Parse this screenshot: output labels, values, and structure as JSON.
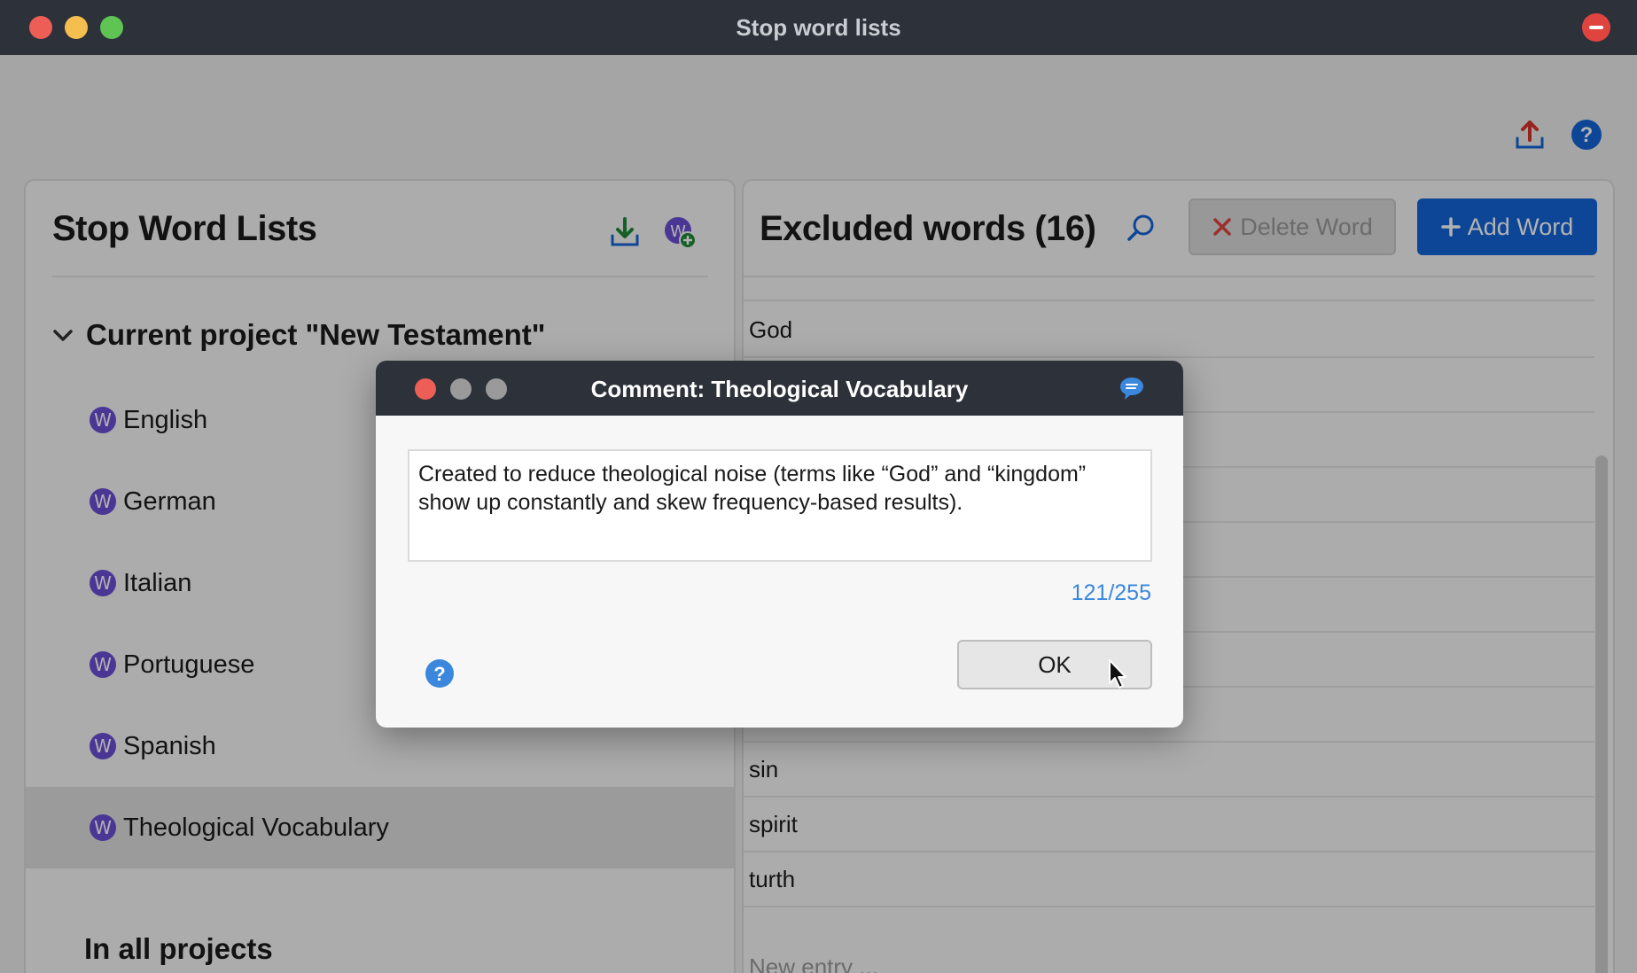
{
  "window": {
    "title": "Stop word lists"
  },
  "left_panel": {
    "title": "Stop Word Lists",
    "group_current": "Current project \"New Testament\"",
    "badge_letter": "W",
    "items": [
      {
        "label": "English"
      },
      {
        "label": "German"
      },
      {
        "label": "Italian"
      },
      {
        "label": "Portuguese"
      },
      {
        "label": "Spanish"
      },
      {
        "label": "Theological Vocabulary"
      }
    ],
    "group_all": "In all projects"
  },
  "right_panel": {
    "title": "Excluded words (16)",
    "delete_label": "Delete Word",
    "add_label": "Add Word",
    "words_visible": [
      "God",
      "sin",
      "spirit",
      "turth"
    ],
    "new_entry_placeholder": "New entry ..."
  },
  "dialog": {
    "title": "Comment: Theological Vocabulary",
    "comment": "Created to reduce theological noise (terms like “God” and “kingdom” show up constantly and skew frequency-based results).",
    "char_count": "121/255",
    "ok_label": "OK"
  },
  "colors": {
    "accent_blue": "#1565d8",
    "badge_purple": "#6b4fd6",
    "close_red": "#e0443e",
    "download_green": "#1f8a3a",
    "upload_red": "#d9312b",
    "help_blue": "#3a87dd"
  },
  "icons": [
    "upload-icon",
    "help-icon",
    "download-icon",
    "add-list-icon",
    "search-icon",
    "chevron-down-icon",
    "comment-icon",
    "close-x-icon",
    "plus-icon"
  ]
}
